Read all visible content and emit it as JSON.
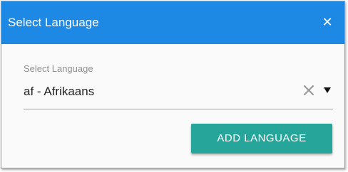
{
  "dialog": {
    "title": "Select Language",
    "close_icon": "close-icon",
    "header_color": "#1e88e5"
  },
  "language_field": {
    "label": "Select Language",
    "value": "af - Afrikaans",
    "clear_icon": "clear-icon",
    "dropdown_icon": "caret-down-icon"
  },
  "actions": {
    "add_label": "ADD LANGUAGE",
    "button_color": "#26a69a"
  }
}
